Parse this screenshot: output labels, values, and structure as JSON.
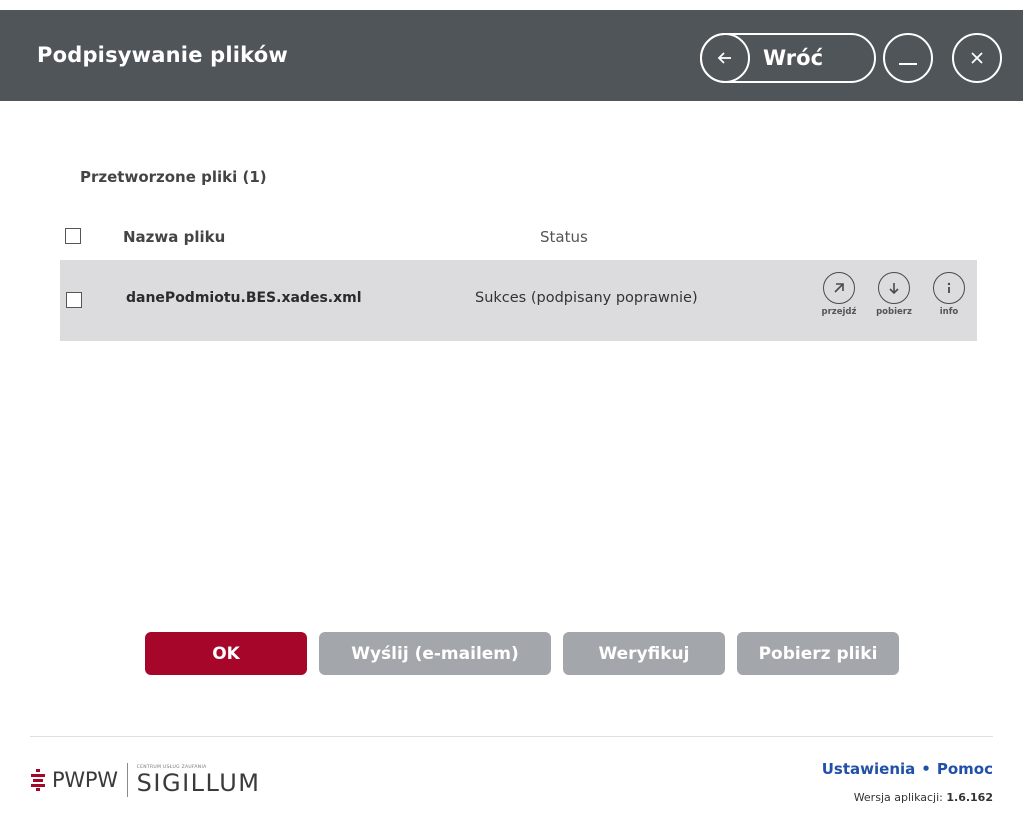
{
  "header": {
    "title": "Podpisywanie plików",
    "back_label": "Wróć"
  },
  "files_section": {
    "title": "Przetworzone pliki (1)",
    "columns": {
      "name": "Nazwa pliku",
      "status": "Status"
    },
    "rows": [
      {
        "file_name": "danePodmiotu.BES.xades.xml",
        "status": "Sukces (podpisany poprawnie)",
        "actions": {
          "goto": "przejdź",
          "download": "pobierz",
          "info": "info"
        }
      }
    ]
  },
  "buttons": {
    "ok": "OK",
    "send_email": "Wyślij (e-mailem)",
    "verify": "Weryfikuj",
    "download_files": "Pobierz pliki"
  },
  "footer": {
    "logo_pwpw": "PWPW",
    "logo_small": "CENTRUM USŁUG ZAUFANIA",
    "logo_sigillum": "SIGILLUM",
    "link_settings": "Ustawienia",
    "separator": "•",
    "link_help": "Pomoc",
    "version_label": "Wersja aplikacji:",
    "version_value": "1.6.162"
  },
  "colors": {
    "header_bg": "#4f5559",
    "primary_button": "#a6062a",
    "secondary_button": "#a3a6aa",
    "link": "#2150a8",
    "row_bg": "#dcdcde"
  }
}
